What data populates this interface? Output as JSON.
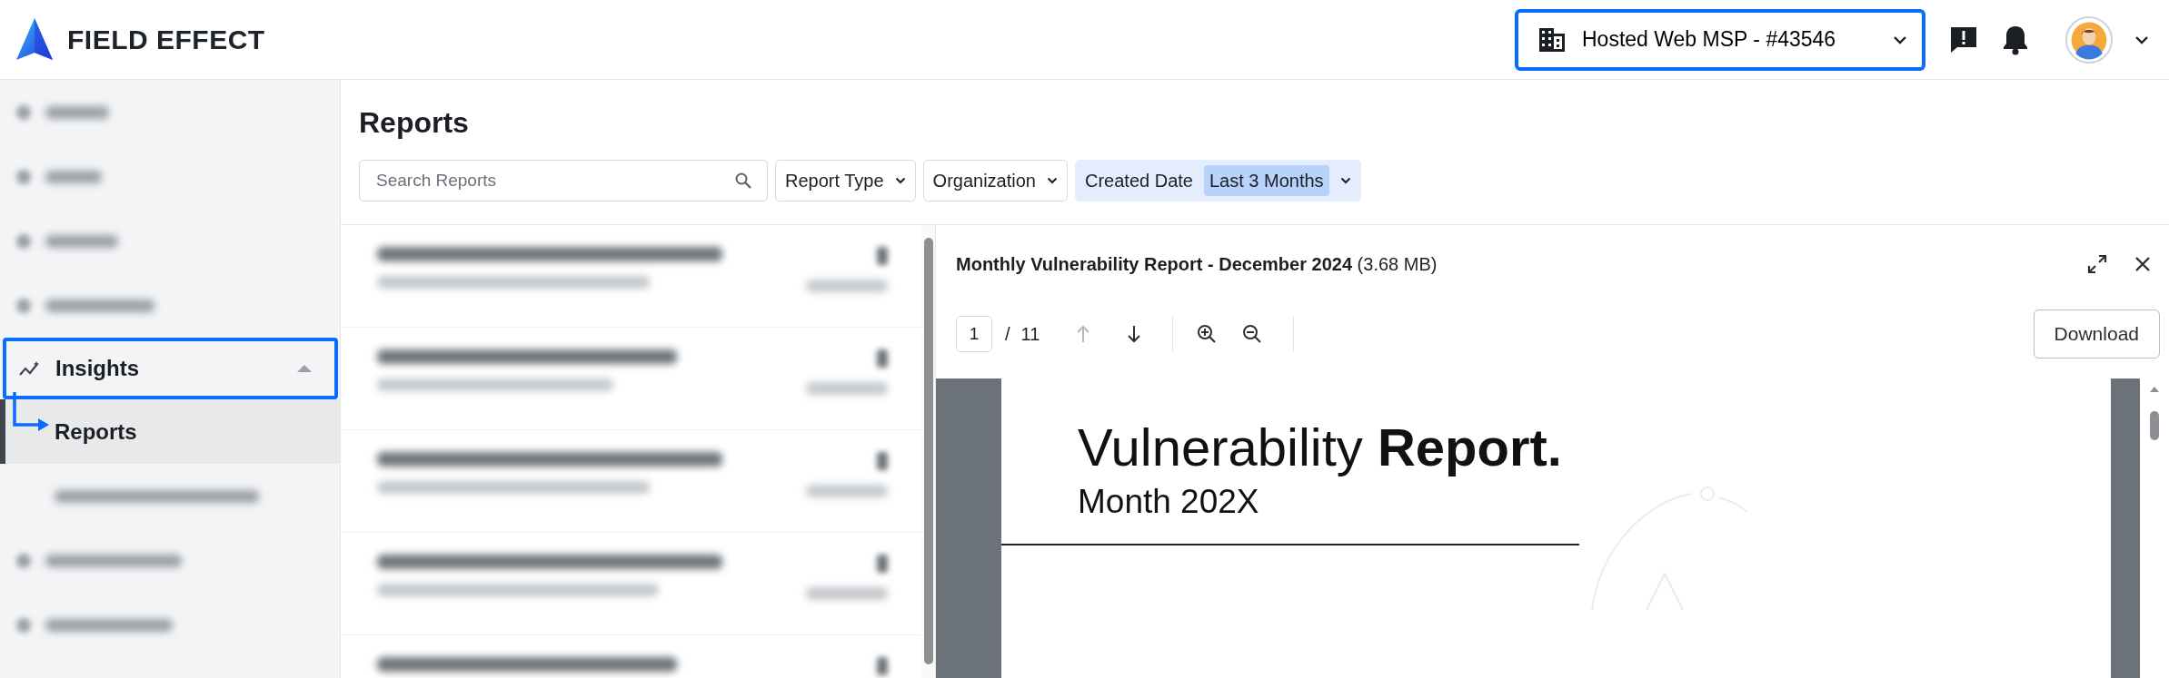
{
  "brand": {
    "name": "FIELD EFFECT"
  },
  "org_selector": {
    "label": "Hosted Web MSP - #43546",
    "highlighted": true
  },
  "sidebar": {
    "items": [
      {
        "kind": "blurred"
      },
      {
        "kind": "blurred"
      },
      {
        "kind": "blurred"
      },
      {
        "kind": "blurred"
      },
      {
        "kind": "group",
        "label": "Insights",
        "expanded": true,
        "highlighted": true,
        "children": [
          {
            "kind": "link",
            "label": "Reports",
            "selected": true
          },
          {
            "kind": "blurred"
          }
        ]
      },
      {
        "kind": "blurred"
      },
      {
        "kind": "blurred"
      }
    ]
  },
  "page": {
    "title": "Reports",
    "search": {
      "placeholder": "Search Reports"
    },
    "filters": [
      {
        "label": "Report Type",
        "active": false
      },
      {
        "label": "Organization",
        "active": false
      },
      {
        "label": "Created Date",
        "value": "Last 3 Months",
        "active": true
      }
    ]
  },
  "report_list": {
    "items": [
      {
        "kind": "blurred"
      },
      {
        "kind": "blurred"
      },
      {
        "kind": "blurred"
      },
      {
        "kind": "blurred"
      },
      {
        "kind": "blurred"
      }
    ]
  },
  "viewer": {
    "title": "Monthly Vulnerability Report - December 2024",
    "size": "(3.68 MB)",
    "page": "1",
    "separator": "/",
    "total": "11",
    "prev_disabled": true,
    "download": "Download",
    "document": {
      "title": "Vulnerability **Report.**",
      "subtitle": "Month 202X"
    }
  }
}
